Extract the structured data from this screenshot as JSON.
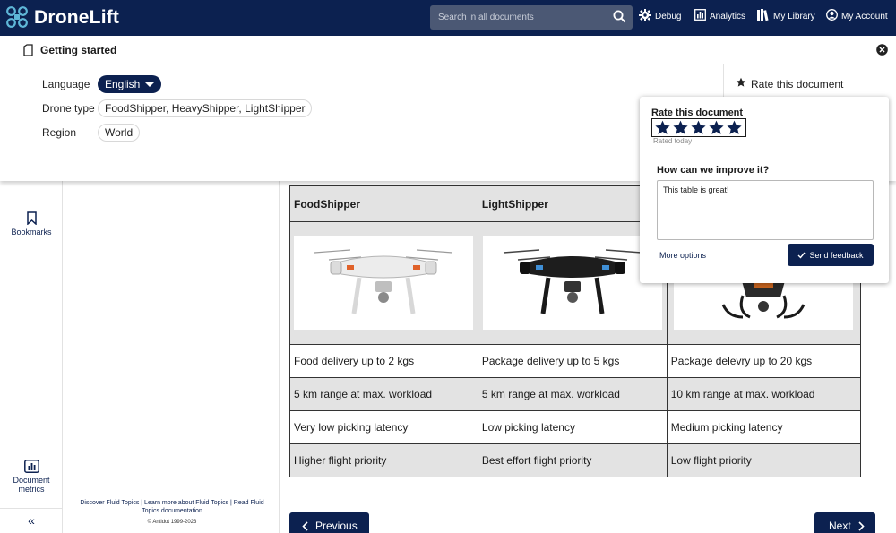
{
  "app": {
    "title": "DroneLift"
  },
  "search": {
    "placeholder": "Search in all documents"
  },
  "nav": [
    {
      "label": "Debug",
      "icon": "gear-icon"
    },
    {
      "label": "Analytics",
      "icon": "bar-chart-icon"
    },
    {
      "label": "My Library",
      "icon": "library-icon"
    },
    {
      "label": "My Account",
      "icon": "user-circle-icon"
    }
  ],
  "getting_started": {
    "title": "Getting started"
  },
  "filters": {
    "language": {
      "label": "Language",
      "value": "English"
    },
    "drone_type": {
      "label": "Drone type",
      "value": "FoodShipper, HeavyShipper, LightShipper"
    },
    "region": {
      "label": "Region",
      "value": "World"
    }
  },
  "rate_link": {
    "label": "Rate this document"
  },
  "left_rail": {
    "bookmarks": "Bookmarks",
    "document_metrics": "Document metrics",
    "collapse": "«"
  },
  "toc_footer": {
    "links": "Discover Fluid Topics | Learn more about Fluid Topics | Read Fluid Topics documentation",
    "copyright": "© Antidot 1999-2023"
  },
  "table": {
    "headers": [
      "FoodShipper",
      "LightShipper",
      ""
    ],
    "rows": [
      [
        "Food delivery up to 2 kgs",
        "Package delivery up to 5 kgs",
        "Package delevry up to 20 kgs"
      ],
      [
        "5 km range at max. workload",
        "5 km range at max. workload",
        "10 km range at max. workload"
      ],
      [
        "Very low picking latency",
        "Low picking latency",
        "Medium picking latency"
      ],
      [
        "Higher flight priority",
        "Best effort flight priority",
        "Low flight priority"
      ]
    ]
  },
  "pager": {
    "previous": "Previous",
    "next": "Next"
  },
  "rating": {
    "title": "Rate this document",
    "stars": 5,
    "rated": "Rated today",
    "question": "How can we improve it?",
    "feedback": "This table is great!",
    "more_options": "More options",
    "send": "Send feedback"
  },
  "colors": {
    "brand": "#0c2150",
    "search_bg": "#4b5874",
    "table_grey": "#e3e3e3"
  }
}
